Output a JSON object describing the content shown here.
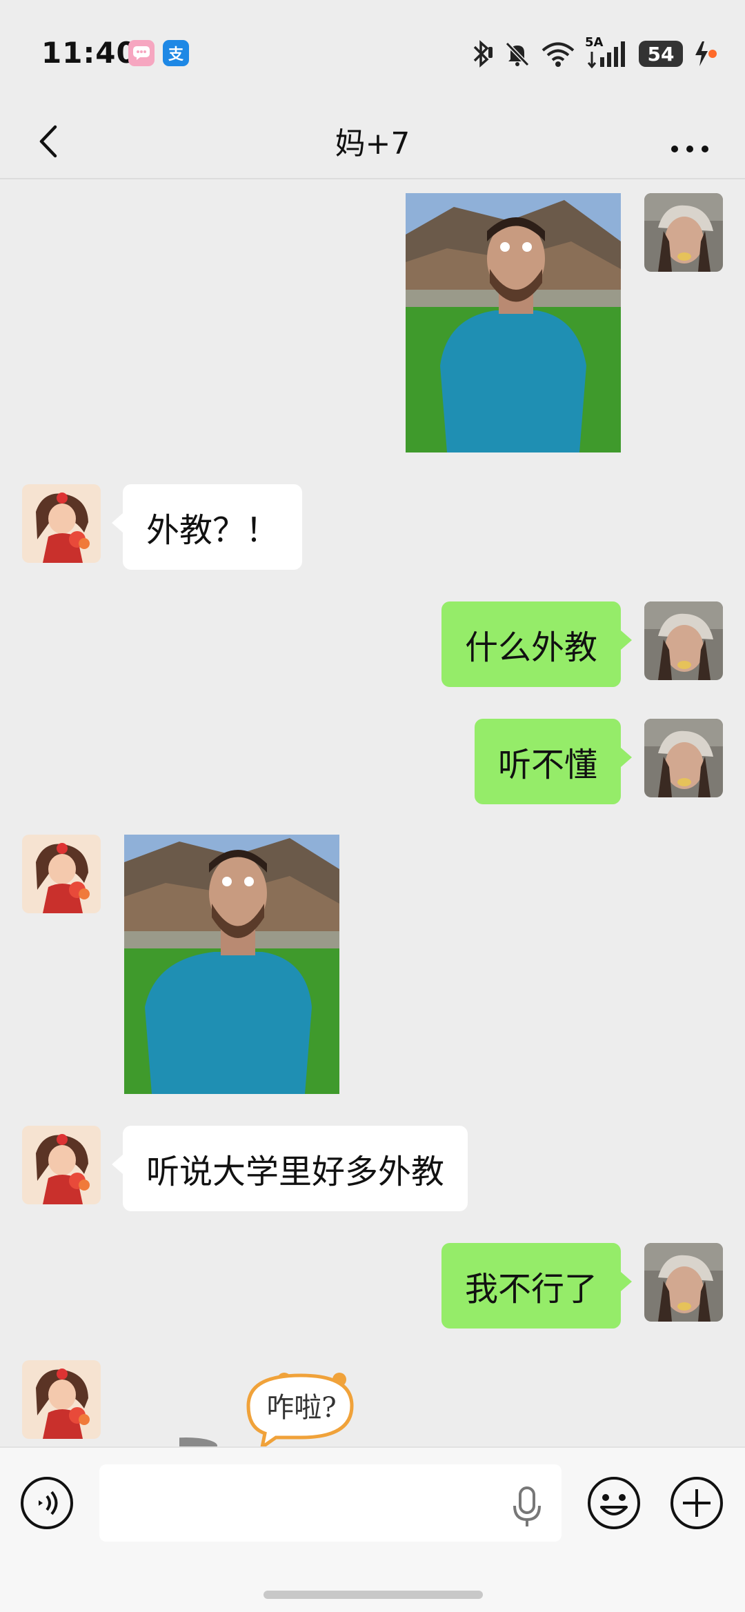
{
  "status_bar": {
    "time": "11:40",
    "alipay_label": "支",
    "network": "5A",
    "battery": "54",
    "icons": [
      "message-app-icon",
      "alipay-icon",
      "bluetooth-icon",
      "mute-icon",
      "wifi-icon",
      "signal-icon",
      "battery-icon",
      "charging-icon"
    ]
  },
  "header": {
    "title": "妈+7",
    "back_icon": "chevron-left-icon",
    "more_icon": "more-dots-icon"
  },
  "messages": [
    {
      "sender": "me",
      "type": "image",
      "content": "photo of a bearded man in a teal t-shirt on a lawn"
    },
    {
      "sender": "other",
      "type": "text",
      "text": "外教？！"
    },
    {
      "sender": "me",
      "type": "text",
      "text": "什么外教"
    },
    {
      "sender": "me",
      "type": "text",
      "text": "听不懂"
    },
    {
      "sender": "other",
      "type": "image",
      "content": "photo of a bearded man in a teal t-shirt on a lawn"
    },
    {
      "sender": "other",
      "type": "text",
      "text": "听说大学里好多外教"
    },
    {
      "sender": "me",
      "type": "text",
      "text": "我不行了"
    },
    {
      "sender": "other",
      "type": "sticker",
      "text": "咋啦?"
    }
  ],
  "input_bar": {
    "voice_icon": "voice-icon",
    "placeholder": "",
    "mic_icon": "microphone-icon",
    "emoji_icon": "emoji-icon",
    "plus_icon": "plus-icon"
  }
}
